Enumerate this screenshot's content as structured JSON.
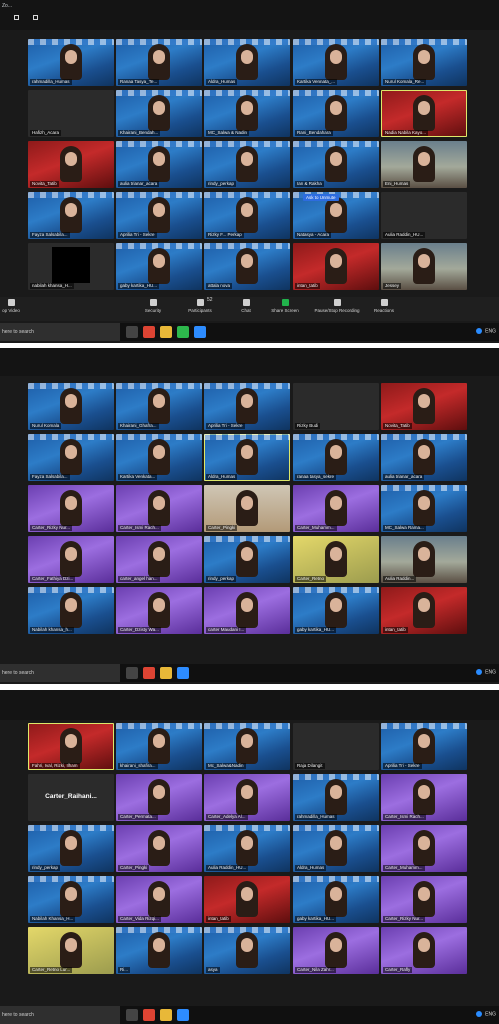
{
  "screen1": {
    "top_text": "Zo...",
    "tiles": [
      {
        "name": "rahmadilla_Humas",
        "bg": "blue"
      },
      {
        "name": "Ranaa Tasya_Te...",
        "bg": "blue"
      },
      {
        "name": "Aldra_Humas",
        "bg": "blue"
      },
      {
        "name": "Kartika Vennata_...",
        "bg": "blue"
      },
      {
        "name": "Nurul Komala_Re...",
        "bg": "blue"
      },
      {
        "name": "Hafizh_Acara",
        "bg": "dark"
      },
      {
        "name": "Khairani_Bendah...",
        "bg": "blue"
      },
      {
        "name": "MC_Salwa & Nadin",
        "bg": "blue"
      },
      {
        "name": "Rani_Bendahara",
        "bg": "blue"
      },
      {
        "name": "Nadia Nabila Kayo...",
        "bg": "red",
        "active": true
      },
      {
        "name": "Novita_Tatib",
        "bg": "red"
      },
      {
        "name": "aulia trianar_acara",
        "bg": "blue"
      },
      {
        "name": "rindy_perkap",
        "bg": "blue"
      },
      {
        "name": "Ian & Rakha",
        "bg": "blue"
      },
      {
        "name": "Eni_Humas",
        "bg": "room"
      },
      {
        "name": "Fayza Salsabila...",
        "bg": "blue"
      },
      {
        "name": "Aprilia Tri - Sekre",
        "bg": "blue"
      },
      {
        "name": "Rizky F... Perkap",
        "bg": "blue"
      },
      {
        "name": "Natasya - Acara",
        "bg": "blue",
        "tag": "Ask to Unmute"
      },
      {
        "name": "Aulia Raddin_HU...",
        "bg": "dark"
      },
      {
        "name": "nabilah khansa_H...",
        "bg": "dark",
        "black": true
      },
      {
        "name": "gaby kartika_HU...",
        "bg": "blue"
      },
      {
        "name": "attala nova",
        "bg": "blue"
      },
      {
        "name": "intan_tatib",
        "bg": "red"
      },
      {
        "name": "Jessey",
        "bg": "room"
      }
    ],
    "toolbar": {
      "stop_video": "op Video",
      "security": "Security",
      "participants": "Participants",
      "participants_count": "52",
      "chat": "Chat",
      "share_screen": "Share Screen",
      "record": "Pause/Stop Recording",
      "reactions": "Reactions"
    }
  },
  "screen2": {
    "tiles": [
      {
        "name": "Nurul Komala",
        "bg": "blue"
      },
      {
        "name": "Khairani_Ghafra...",
        "bg": "blue"
      },
      {
        "name": "Aprilia Tri - Sekre",
        "bg": "blue"
      },
      {
        "name": "Rizky Budi",
        "bg": "dark"
      },
      {
        "name": "Novita_Tatib",
        "bg": "red"
      },
      {
        "name": "Fayza Salsabila...",
        "bg": "blue"
      },
      {
        "name": "Kartika Venkata...",
        "bg": "blue"
      },
      {
        "name": "Aldra_Humas",
        "bg": "blue",
        "active": true
      },
      {
        "name": "ranaa tasya_sekre",
        "bg": "blue"
      },
      {
        "name": "aulia trianar_acara",
        "bg": "blue"
      },
      {
        "name": "Carter_Rizky Nur...",
        "bg": "purple"
      },
      {
        "name": "Carter_Ismi Rach...",
        "bg": "purple"
      },
      {
        "name": "Carter_Pingki",
        "bg": "wall"
      },
      {
        "name": "Carter_Muhamm...",
        "bg": "purple"
      },
      {
        "name": "MC_Salwa Rama...",
        "bg": "blue"
      },
      {
        "name": "Carter_Fathiya Dzi...",
        "bg": "purple"
      },
      {
        "name": "carter_angel han...",
        "bg": "purple"
      },
      {
        "name": "rindy_perkap",
        "bg": "blue"
      },
      {
        "name": "Carter_Retno",
        "bg": "yellow"
      },
      {
        "name": "Aulia Raddin...",
        "bg": "room"
      },
      {
        "name": "Nabilah khansa_h...",
        "bg": "blue"
      },
      {
        "name": "Carter_Dzisty Wa...",
        "bg": "purple"
      },
      {
        "name": "carter Maudani I...",
        "bg": "purple"
      },
      {
        "name": "gaby kartika_HU...",
        "bg": "blue"
      },
      {
        "name": "intan_tatib",
        "bg": "red"
      }
    ]
  },
  "screen3": {
    "tiles": [
      {
        "name": "Fahri, Ival, Rizki, Ilham",
        "bg": "red",
        "active": true
      },
      {
        "name": "khairani_shafira...",
        "bg": "blue"
      },
      {
        "name": "Mc_Salwa&Nadin",
        "bg": "blue"
      },
      {
        "name": "Raja Dilangit",
        "bg": "dark"
      },
      {
        "name": "Aprilia Tri - Sekre",
        "bg": "blue"
      },
      {
        "name": "",
        "bg": "dark",
        "plain": "Carter_Raihani..."
      },
      {
        "name": "Carter_Permata...",
        "bg": "purple"
      },
      {
        "name": "Carter_Adelya Al...",
        "bg": "purple"
      },
      {
        "name": "rahmadilla_Humas",
        "bg": "blue"
      },
      {
        "name": "Carter_Ismi Rach...",
        "bg": "purple"
      },
      {
        "name": "rindy_perkap",
        "bg": "blue"
      },
      {
        "name": "Carter_Pingki",
        "bg": "purple"
      },
      {
        "name": "Aulia Raddin_HU...",
        "bg": "blue"
      },
      {
        "name": "Aldra_Humas",
        "bg": "blue"
      },
      {
        "name": "Carter_Muhamm...",
        "bg": "purple"
      },
      {
        "name": "Nabilah Khansa_H...",
        "bg": "blue"
      },
      {
        "name": "Carter_Vida Rizqi...",
        "bg": "purple"
      },
      {
        "name": "intan_tatib",
        "bg": "red"
      },
      {
        "name": "gaby kartika_HU...",
        "bg": "blue"
      },
      {
        "name": "Carter_Rizky Nur...",
        "bg": "purple"
      },
      {
        "name": "Carter_Retno Lur...",
        "bg": "yellow"
      },
      {
        "name": "Ri...",
        "bg": "blue"
      },
      {
        "name": "asya",
        "bg": "blue"
      },
      {
        "name": "Carter_Nila Zahr...",
        "bg": "purple"
      },
      {
        "name": "Carter_Rafly",
        "bg": "purple"
      }
    ]
  },
  "taskbar": {
    "search_placeholder": "here to search",
    "language": "ENG"
  }
}
